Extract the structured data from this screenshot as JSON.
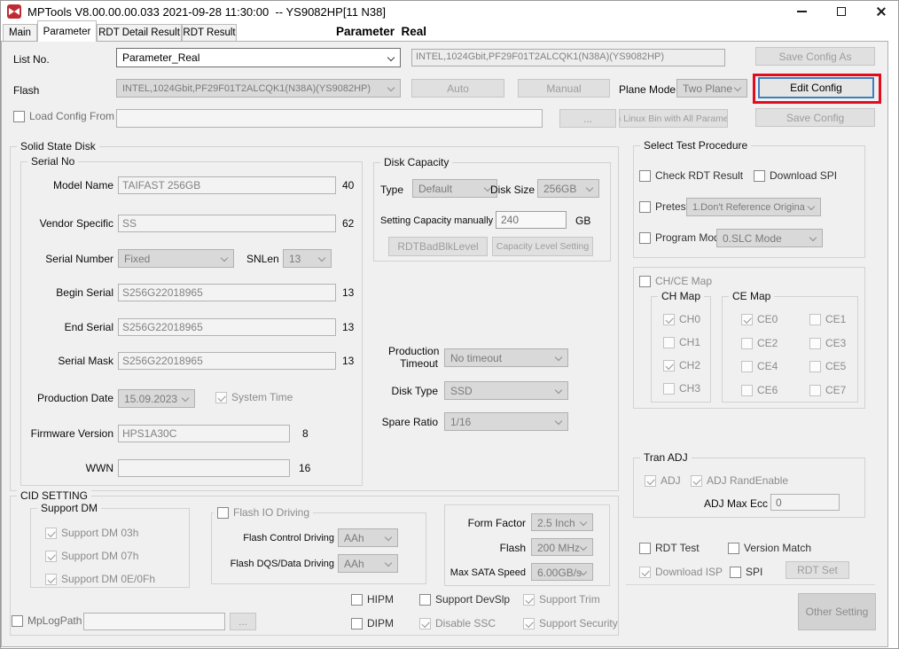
{
  "window": {
    "title": "MPTools V8.00.00.00.033 2021-09-28 11:30:00  -- YS9082HP[11 N38]"
  },
  "tabs": {
    "main": "Main",
    "parameter": "Parameter",
    "rdt_detail": "RDT Detail Result",
    "rdt_result": "RDT Result",
    "page_title": "Parameter  Real"
  },
  "top": {
    "list_no_label": "List No.",
    "list_no_value": "Parameter_Real",
    "flash_info": "INTEL,1024Gbit,PF29F01T2ALCQK1(N38A)(YS9082HP)",
    "save_config_as": "Save Config As",
    "flash_label": "Flash",
    "flash_value": "INTEL,1024Gbit,PF29F01T2ALCQK1(N38A)(YS9082HP)",
    "auto": "Auto",
    "manual": "Manual",
    "plane_mode_label": "Plane Mode",
    "plane_mode_value": "Two Plane",
    "edit_config": "Edit Config",
    "load_config": {
      "label": "Load Config From",
      "checked": false
    },
    "load_config_path": "",
    "browse": "...",
    "linux_bin": "n Linux Bin with All Paramet",
    "save_config": "Save Config"
  },
  "ssd": {
    "title": "Solid State Disk"
  },
  "serial": {
    "title": "Serial No",
    "model_name": {
      "label": "Model Name",
      "value": "TAIFAST 256GB",
      "len": "40"
    },
    "vendor_specific": {
      "label": "Vendor Specific",
      "value": "SS",
      "len": "62"
    },
    "serial_number": {
      "label": "Serial Number",
      "value": "Fixed"
    },
    "snlen": {
      "label": "SNLen",
      "value": "13"
    },
    "begin_serial": {
      "label": "Begin Serial",
      "value": "S256G22018965",
      "len": "13"
    },
    "end_serial": {
      "label": "End Serial",
      "value": "S256G22018965",
      "len": "13"
    },
    "serial_mask": {
      "label": "Serial Mask",
      "value": "S256G22018965",
      "len": "13"
    },
    "production_date": {
      "label": "Production Date",
      "value": "15.09.2023"
    },
    "system_time": {
      "label": "System Time",
      "checked": true
    },
    "firmware_version": {
      "label": "Firmware Version",
      "value": "HPS1A30C",
      "len": "8"
    },
    "wwn": {
      "label": "WWN",
      "value": "",
      "len": "16"
    }
  },
  "capacity": {
    "title": "Disk Capacity",
    "type_label": "Type",
    "type_value": "Default",
    "disk_size_label": "Disk Size",
    "disk_size_value": "256GB",
    "manual_label": "Setting Capacity manually",
    "manual_value": "240",
    "unit": "GB",
    "rdt_badblk": "RDTBadBlkLevel",
    "capacity_level": "Capacity Level Setting"
  },
  "middle": {
    "production_timeout_label": "Production Timeout",
    "production_timeout_value": "No timeout",
    "disk_type_label": "Disk Type",
    "disk_type_value": "SSD",
    "spare_ratio_label": "Spare Ratio",
    "spare_ratio_value": "1/16"
  },
  "test": {
    "title": "Select Test Procedure",
    "check_rdt": {
      "label": "Check RDT Result",
      "checked": false
    },
    "download_spi": {
      "label": "Download SPI",
      "checked": false
    },
    "pretest": {
      "label": "Pretest",
      "checked": false
    },
    "pretest_value": "1.Don't Reference Origina",
    "program_mode": {
      "label": "Program Mode",
      "checked": false
    },
    "program_mode_value": "0.SLC Mode"
  },
  "chce": {
    "map": {
      "label": "CH/CE Map",
      "checked": false
    },
    "ch_title": "CH Map",
    "ce_title": "CE Map",
    "ch": [
      {
        "label": "CH0",
        "checked": true
      },
      {
        "label": "CH1",
        "checked": false
      },
      {
        "label": "CH2",
        "checked": true
      },
      {
        "label": "CH3",
        "checked": false
      }
    ],
    "ce": [
      {
        "label": "CE0",
        "checked": true
      },
      {
        "label": "CE1",
        "checked": false
      },
      {
        "label": "CE2",
        "checked": false
      },
      {
        "label": "CE3",
        "checked": false
      },
      {
        "label": "CE4",
        "checked": false
      },
      {
        "label": "CE5",
        "checked": false
      },
      {
        "label": "CE6",
        "checked": false
      },
      {
        "label": "CE7",
        "checked": false
      }
    ]
  },
  "tran": {
    "title": "Tran ADJ",
    "adj": {
      "label": "ADJ",
      "checked": true
    },
    "rand": {
      "label": "ADJ RandEnable",
      "checked": true
    },
    "max_ecc_label": "ADJ Max Ecc",
    "max_ecc_value": "0"
  },
  "rdt": {
    "rdt_test": {
      "label": "RDT Test",
      "checked": false
    },
    "version_match": {
      "label": "Version Match",
      "checked": false
    },
    "download_isp": {
      "label": "Download ISP",
      "checked": true
    },
    "spi": {
      "label": "SPI",
      "checked": false
    },
    "rdt_set": "RDT Set",
    "other_setting": "Other Setting"
  },
  "cid": {
    "title": "CID SETTING",
    "support_dm_title": "Support DM",
    "dm03": {
      "label": "Support DM 03h",
      "checked": true
    },
    "dm07": {
      "label": "Support DM 07h",
      "checked": true
    },
    "dm0e": {
      "label": "Support DM 0E/0Fh",
      "checked": true
    },
    "flash_io": {
      "label": "Flash IO Driving",
      "checked": false
    },
    "flash_control_label": "Flash Control Driving",
    "flash_control_value": "AAh",
    "flash_dqs_label": "Flash DQS/Data Driving",
    "flash_dqs_value": "AAh",
    "form_factor_label": "Form Factor",
    "form_factor_value": "2.5 Inch",
    "flash_freq_label": "Flash",
    "flash_freq_value": "200 MHz",
    "max_sata_label": "Max SATA Speed",
    "max_sata_value": "6.00GB/s",
    "hipm": {
      "label": "HIPM",
      "checked": false
    },
    "dipm": {
      "label": "DIPM",
      "checked": false
    },
    "devslp": {
      "label": "Support DevSlp",
      "checked": false
    },
    "disable_ssc": {
      "label": "Disable SSC",
      "checked": true
    },
    "trim": {
      "label": "Support Trim",
      "checked": true
    },
    "security": {
      "label": "Support Security",
      "checked": true
    },
    "mplog": {
      "label": "MpLogPath",
      "checked": false
    },
    "mplog_path": "",
    "mplog_browse": "..."
  },
  "colors": {
    "highlight_red": "#e30b1c",
    "focus_blue": "#3c80c0",
    "logo_red": "#bf2b33",
    "panel_bg": "#f0f0f0"
  }
}
